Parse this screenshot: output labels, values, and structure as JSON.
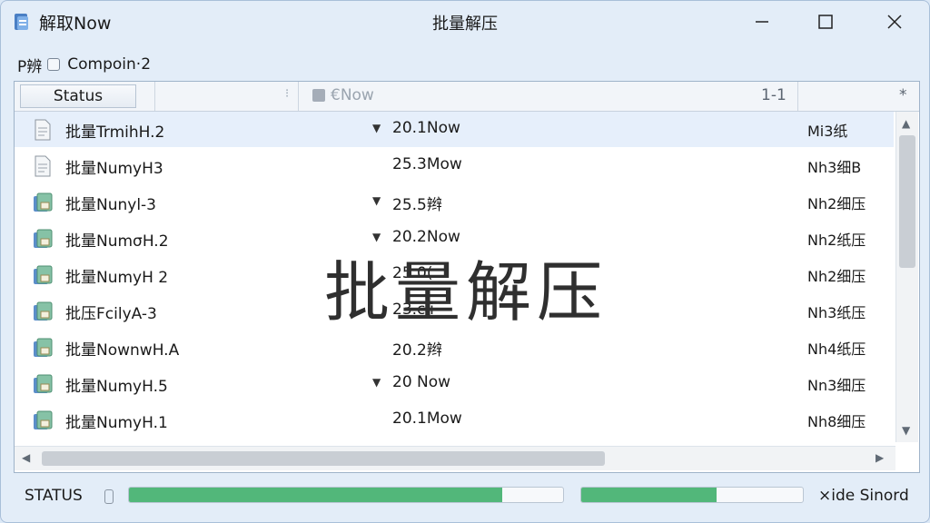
{
  "window": {
    "app_title": "解取Now",
    "center_title": "批量解压",
    "overlay_text": "批量解压"
  },
  "path": {
    "prefix": "P辨",
    "label": "Compoin·2"
  },
  "columns": {
    "status": "Status",
    "now": "€Now",
    "count": "1-1",
    "star": "*"
  },
  "rows": [
    {
      "name": "批量TrmihH.2",
      "value": "20.1Now",
      "size": "Mi3纸",
      "arrow": true,
      "selected": true,
      "icon": "document-icon"
    },
    {
      "name": "批量NumyH3",
      "value": "25.3Mow",
      "size": "Nh3细B",
      "arrow": false,
      "selected": false,
      "icon": "document-icon"
    },
    {
      "name": "批量Nunyl-3",
      "value": "25.5辫",
      "size": "Nh2细压",
      "arrow": true,
      "selected": false,
      "icon": "archive-file-icon"
    },
    {
      "name": "批量NumσH.2",
      "value": "20.2Now",
      "size": "Nh2纸压",
      "arrow": true,
      "selected": false,
      "icon": "archive-file-icon"
    },
    {
      "name": "批量NumyH 2",
      "value": "25.0(",
      "size": "Nh2细压",
      "arrow": false,
      "selected": false,
      "icon": "archive-file-icon"
    },
    {
      "name": "批压FcilyA-3",
      "value": "23.cli",
      "size": "Nh3纸压",
      "arrow": false,
      "selected": false,
      "icon": "archive-file-icon"
    },
    {
      "name": "批量NownwH.A",
      "value": "20.2辫",
      "size": "Nh4纸压",
      "arrow": false,
      "selected": false,
      "icon": "archive-file-icon"
    },
    {
      "name": "批量NumyH.5",
      "value": "20 Now",
      "size": "Nn3细压",
      "arrow": true,
      "selected": false,
      "icon": "archive-file-icon"
    },
    {
      "name": "批量NumyH.1",
      "value": "20.1Mow",
      "size": "Nh8细压",
      "arrow": false,
      "selected": false,
      "icon": "archive-file-icon"
    }
  ],
  "status_bar": {
    "label": "STATUS",
    "progress_1": 0.86,
    "progress_2": 0.61,
    "right_text": "×ide Sinord"
  },
  "colors": {
    "progress": "#52b77a",
    "accent": "#2f6db5",
    "selection": "#e6effb"
  }
}
